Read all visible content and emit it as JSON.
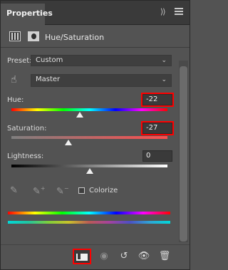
{
  "tab": {
    "title": "Properties",
    "close": "×",
    "collapse": "⟩⟩"
  },
  "adjustment": {
    "title": "Hue/Saturation"
  },
  "preset": {
    "label": "Preset:",
    "value": "Custom"
  },
  "channel": {
    "value": "Master"
  },
  "hue": {
    "label": "Hue:",
    "value": "-22",
    "level": -22,
    "range": [
      -180,
      180
    ]
  },
  "saturation": {
    "label": "Saturation:",
    "value": "-27",
    "level": -27,
    "range": [
      -100,
      100
    ]
  },
  "lightness": {
    "label": "Lightness:",
    "value": "0",
    "level": 0,
    "range": [
      -100,
      100
    ]
  },
  "colorize": {
    "label": "Colorize",
    "checked": false
  },
  "icons": {
    "layer_mask": "layer-mask-icon",
    "adjustment": "hue-saturation-icon",
    "target": "targeted-adjustment-hand-icon",
    "dropper": "eyedropper-icon",
    "dropper_add": "eyedropper-add-icon",
    "dropper_sub": "eyedropper-subtract-icon",
    "clip": "clip-to-layer-icon",
    "view_prev": "view-previous-state-icon",
    "reset": "reset-icon",
    "visibility": "eye-icon",
    "delete": "trash-icon"
  },
  "colors": {
    "highlight": "#ff0000",
    "panel_bg": "#535353"
  }
}
